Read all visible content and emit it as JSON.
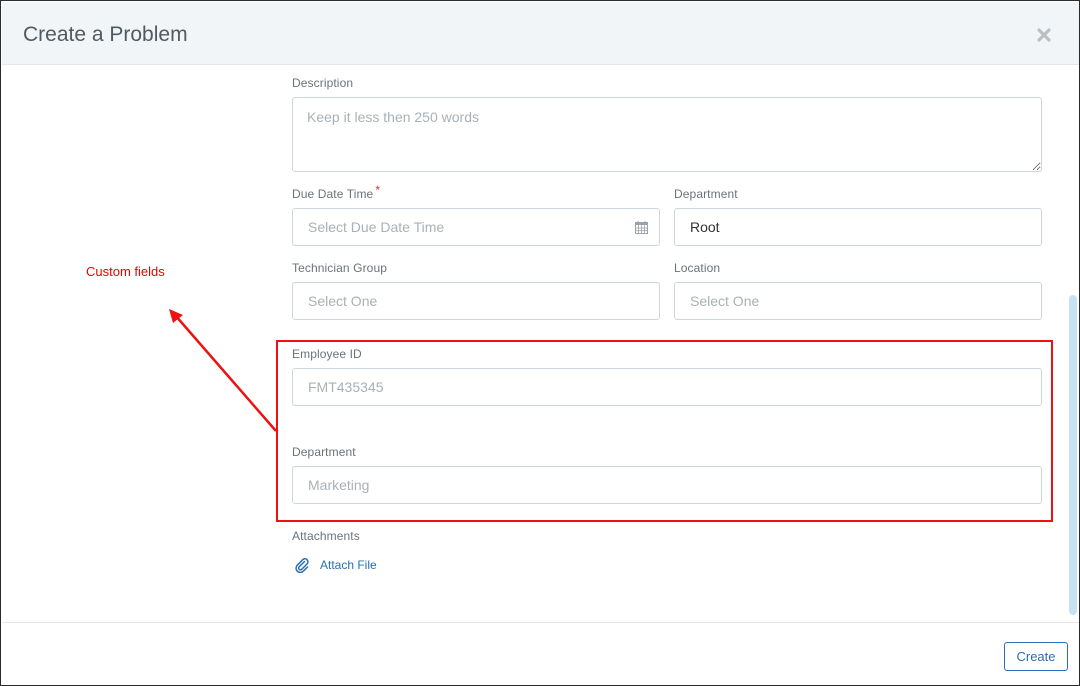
{
  "modal": {
    "title": "Create a Problem"
  },
  "form": {
    "description": {
      "label": "Description",
      "placeholder": "Keep it less then 250 words"
    },
    "due_date_time": {
      "label": "Due Date Time",
      "required_mark": "*",
      "placeholder": "Select Due Date Time"
    },
    "department": {
      "label": "Department",
      "value": "Root"
    },
    "technician_group": {
      "label": "Technician Group",
      "placeholder": "Select One"
    },
    "location": {
      "label": "Location",
      "placeholder": "Select One"
    },
    "custom_fields": {
      "employee_id": {
        "label": "Employee ID",
        "placeholder": "FMT435345"
      },
      "department": {
        "label": "Department",
        "placeholder": "Marketing"
      }
    },
    "attachments": {
      "label": "Attachments",
      "attach_file_label": "Attach File"
    }
  },
  "annotation": {
    "text": "Custom fields",
    "color": "#ee1111"
  },
  "footer": {
    "create_label": "Create"
  },
  "icons": {
    "close": "close-icon",
    "calendar": "calendar-icon",
    "paperclip": "paperclip-icon"
  },
  "colors": {
    "accent": "#2a6fb5",
    "header_bg": "#f1f5f8",
    "required": "#e0282e",
    "scrollbar": "#c8e1f3"
  }
}
